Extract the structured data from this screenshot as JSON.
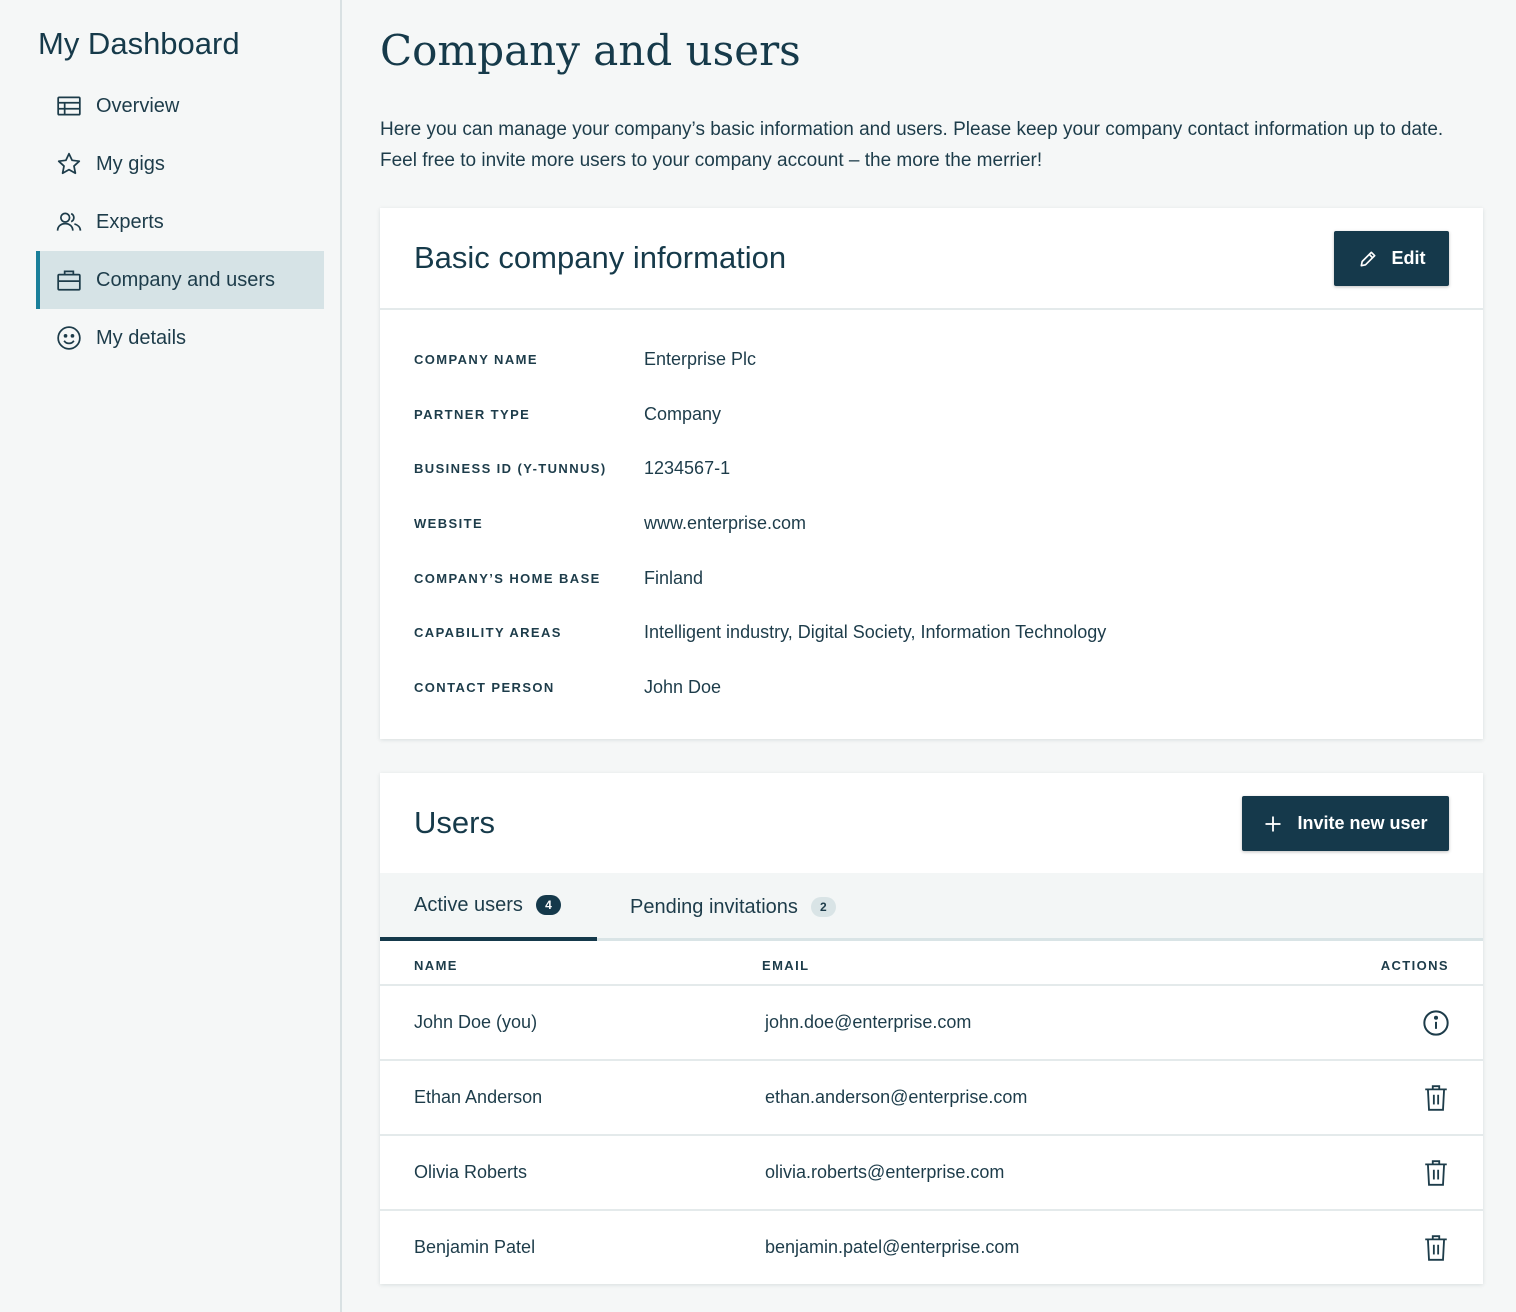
{
  "sidebar": {
    "title": "My Dashboard",
    "items": [
      {
        "label": "Overview",
        "icon": "table-icon"
      },
      {
        "label": "My gigs",
        "icon": "star-icon"
      },
      {
        "label": "Experts",
        "icon": "users-icon"
      },
      {
        "label": "Company and users",
        "icon": "briefcase-icon",
        "active": true
      },
      {
        "label": "My details",
        "icon": "smiley-icon"
      }
    ]
  },
  "main": {
    "title": "Company and users",
    "intro": "Here you can manage your company’s basic information and users. Please keep your company contact information up to date. Feel free to invite more users to your company account – the more the merrier!"
  },
  "company_card": {
    "title": "Basic company information",
    "edit_label": "Edit",
    "rows": [
      {
        "label": "COMPANY NAME",
        "value": "Enterprise Plc"
      },
      {
        "label": "PARTNER TYPE",
        "value": "Company"
      },
      {
        "label": "BUSINESS ID (Y-TUNNUS)",
        "value": "1234567-1"
      },
      {
        "label": "WEBSITE",
        "value": "www.enterprise.com"
      },
      {
        "label": "COMPANY’S HOME BASE",
        "value": "Finland"
      },
      {
        "label": "CAPABILITY AREAS",
        "value": "Intelligent industry, Digital Society, Information Technology"
      },
      {
        "label": "CONTACT PERSON",
        "value": "John Doe"
      }
    ]
  },
  "users_card": {
    "title": "Users",
    "invite_label": "Invite new user",
    "tabs": {
      "active_label": "Active users",
      "active_count": "4",
      "pending_label": "Pending invitations",
      "pending_count": "2"
    },
    "columns": {
      "name": "NAME",
      "email": "EMAIL",
      "actions": "ACTIONS"
    },
    "users": [
      {
        "name": "John Doe (you)",
        "email": "john.doe@enterprise.com",
        "action": "info-icon"
      },
      {
        "name": "Ethan Anderson",
        "email": "ethan.anderson@enterprise.com",
        "action": "trash-icon"
      },
      {
        "name": "Olivia Roberts",
        "email": "olivia.roberts@enterprise.com",
        "action": "trash-icon"
      },
      {
        "name": "Benjamin Patel",
        "email": "benjamin.patel@enterprise.com",
        "action": "trash-icon"
      }
    ]
  },
  "colors": {
    "primary": "#15394b",
    "accent": "#1a7f9a",
    "active_nav_bg": "#d6e3e6",
    "background": "#f5f7f7"
  }
}
